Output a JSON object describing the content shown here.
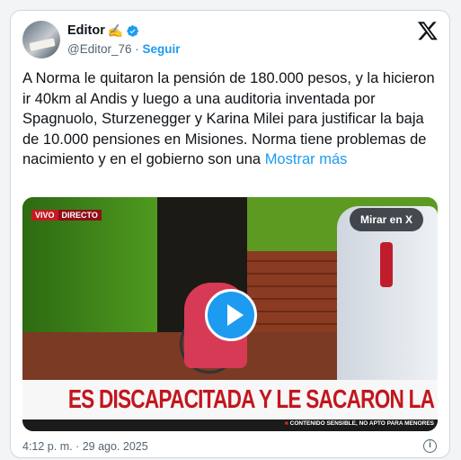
{
  "author": {
    "name": "Editor",
    "emoji": "✍️",
    "handle": "@Editor_76",
    "separator": "·",
    "follow_label": "Seguir"
  },
  "icons": {
    "verified": "verified-badge-icon",
    "x_logo": "x-logo-icon",
    "info": "info-icon",
    "play": "play-icon"
  },
  "tweet": {
    "text": "A Norma le quitaron la pensión de 180.000 pesos, y la hicieron ir 40km al Andis y luego a una auditoria inventada por Spagnuolo, Sturzenegger y Karina Milei para justificar la baja de 10.000 pensiones en Misiones. Norma tiene problemas de nacimiento  y en el gobierno son una ",
    "more_label": "Mostrar más"
  },
  "media": {
    "live_label": "VIVO",
    "live_label2": "DIRECTO",
    "watch_label": "Mirar en X",
    "banner": "ES DISCAPACITADA Y LE SACARON LA PENSIÓN",
    "warning": "CONTENIDO SENSIBLE, NO APTO PARA MENORES"
  },
  "footer": {
    "timestamp": "4:12 p. m. · 29 ago. 2025",
    "info_label": "i"
  },
  "colors": {
    "accent": "#1d9bf0",
    "text": "#0f1419",
    "muted": "#536471",
    "banner_red": "#c3161e"
  }
}
